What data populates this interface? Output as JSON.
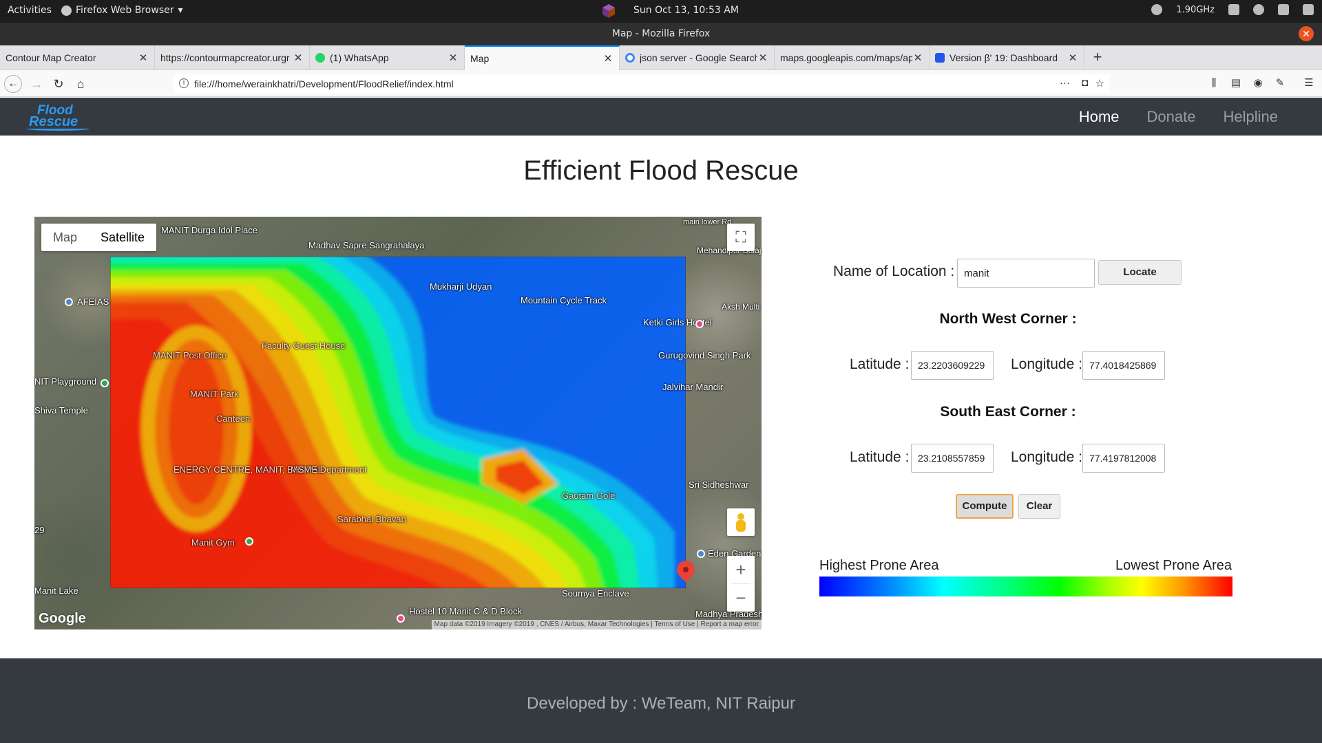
{
  "system": {
    "activities": "Activities",
    "app_name": "Firefox Web Browser",
    "clock": "Sun Oct 13, 10:53 AM",
    "cpu_freq": "1.90GHz"
  },
  "window": {
    "title": "Map - Mozilla Firefox"
  },
  "tabs": [
    {
      "label": "Contour Map Creator",
      "active": false
    },
    {
      "label": "https://contourmapcreator.urgr",
      "active": false
    },
    {
      "label": "(1) WhatsApp",
      "active": false
    },
    {
      "label": "Map",
      "active": true
    },
    {
      "label": "json server - Google Search",
      "active": false
    },
    {
      "label": "maps.googleapis.com/maps/api",
      "active": false
    },
    {
      "label": "Version β' 19: Dashboard",
      "active": false
    }
  ],
  "urlbar": {
    "url": "file:///home/werainkhatri/Development/FloodRelief/index.html"
  },
  "site": {
    "logo_line1": "Flood",
    "logo_line2": "Rescue",
    "nav": {
      "home": "Home",
      "donate": "Donate",
      "helpline": "Helpline"
    },
    "page_title": "Efficient Flood Rescue"
  },
  "map": {
    "type_map": "Map",
    "type_satellite": "Satellite",
    "selected_type": "Satellite",
    "google": "Google",
    "attribution": "Map data ©2019 Imagery ©2019 , CNES / Airbus, Maxar Technologies | Terms of Use | Report a map error",
    "labels": {
      "manit_durga": "MANIT Durga Idol Place",
      "madhav_sapre": "Madhav Sapre Sangrahalaya",
      "mukharji": "Mukharji Udyan",
      "mountain_cycle": "Mountain Cycle Track",
      "ketki": "Ketki Girls Hostel",
      "gurugovind": "Gurugovind Singh Park",
      "jalvihar": "Jalvihar Mandir",
      "afeias": "AFEIAS",
      "manit_post": "MANIT Post Office",
      "faculty_guest": "Faculty Guest House",
      "manit_park": "MANIT Park",
      "nit_playground": "NIT Playground",
      "shiva_temple": "Shiva Temple",
      "canteen": "Canteen",
      "energy_centre": "ENERGY CENTRE, MANIT, BHOPAL",
      "msme": "MSME Department",
      "sarabhai": "Sarabhai Bhavan",
      "manit_gym": "Manit Gym",
      "manit_lake": "Manit Lake",
      "sidheshwar": "Sri Sidheshwar",
      "eden_garden": "Eden Garden",
      "soumya": "Soumya Enclave",
      "hostel10": "Hostel 10 Manit C & D Block",
      "madhya_pradesh": "Madhya Pradesh",
      "mehandipur": "Mehandipur Balaji Hanuman Mandir",
      "aksh": "Aksh Multi Spe",
      "gautam": "Gautam Gole",
      "main_lower": "main lower Rd",
      "twenty_nine": "29"
    }
  },
  "form": {
    "location_label": "Name of Location :",
    "location_value": "manit",
    "locate_button": "Locate",
    "nw_title": "North West Corner :",
    "se_title": "South East Corner :",
    "lat_label": "Latitude :",
    "lng_label": "Longitude :",
    "nw_lat": "23.2203609229",
    "nw_lng": "77.4018425869",
    "se_lat": "23.2108557859",
    "se_lng": "77.4197812008",
    "compute_button": "Compute",
    "clear_button": "Clear"
  },
  "legend": {
    "left_label": "Highest Prone Area",
    "right_label": "Lowest Prone Area",
    "colors": [
      "#0000ff",
      "#00ffff",
      "#00ff00",
      "#ffff00",
      "#ff0000"
    ]
  },
  "footer": {
    "text": "Developed by : WeTeam, NIT Raipur"
  }
}
